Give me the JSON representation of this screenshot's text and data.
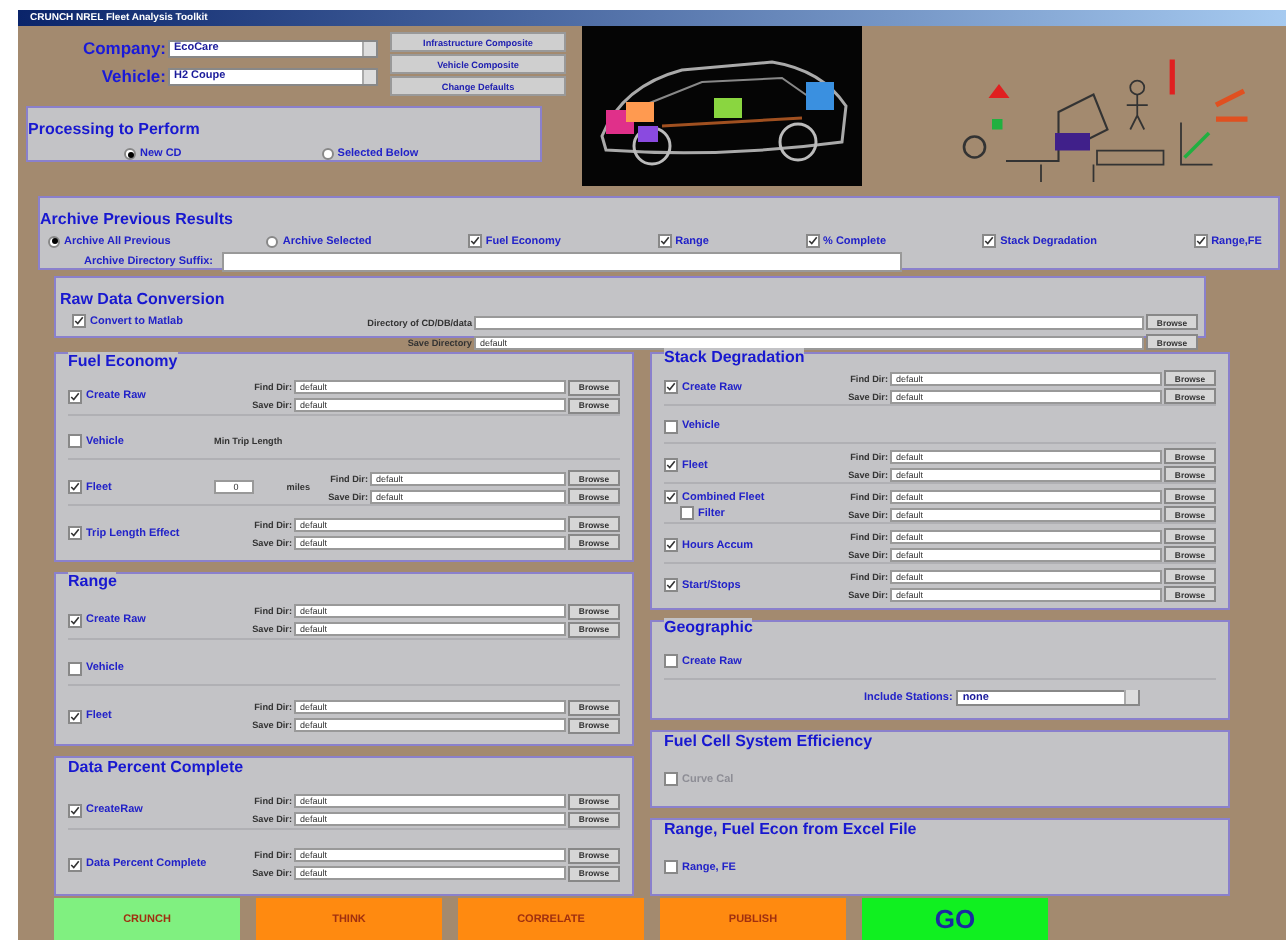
{
  "window": {
    "title": "CRUNCH NREL Fleet Analysis Toolkit"
  },
  "selectors": [
    {
      "label": "Company:",
      "value": "EcoCare"
    },
    {
      "label": "Vehicle:",
      "value": "H2 Coupe"
    }
  ],
  "top_buttons": [
    "Infrastructure Composite",
    "Vehicle Composite",
    "Change Defaults"
  ],
  "processing": {
    "title": "Processing to Perform",
    "options": [
      {
        "label": "New CD",
        "selected": true
      },
      {
        "label": "Selected Below",
        "selected": false
      }
    ]
  },
  "archive": {
    "title": "Archive Previous Results",
    "options": [
      {
        "kind": "radio",
        "label": "Archive All Previous",
        "selected": true
      },
      {
        "kind": "radio",
        "label": "Archive Selected",
        "selected": false
      },
      {
        "kind": "check",
        "label": "Fuel Economy",
        "checked": true
      },
      {
        "kind": "check",
        "label": "Range",
        "checked": true
      },
      {
        "kind": "check",
        "label": "% Complete",
        "checked": true
      },
      {
        "kind": "check",
        "label": "Stack Degradation",
        "checked": true
      },
      {
        "kind": "check",
        "label": "Range,FE",
        "checked": true
      }
    ],
    "suffix_label": "Archive Directory Suffix:"
  },
  "raw_data": {
    "title": "Raw Data Conversion",
    "label": "Convert to Matlab",
    "checked": true,
    "fields": [
      {
        "label": "Directory of CD/DB/data",
        "browse": "Browse"
      },
      {
        "label": "Save Directory",
        "value": "default",
        "browse": "Browse"
      }
    ]
  },
  "left_panels": [
    {
      "title": "Fuel Economy",
      "rows": [
        {
          "label": "Create Raw",
          "checked": true,
          "fields": [
            {
              "label": "Find Dir:",
              "value": "default",
              "browse": "Browse"
            },
            {
              "label": "Save Dir:",
              "value": "default",
              "browse": "Browse"
            }
          ]
        },
        {
          "label": "Vehicle",
          "checked": false,
          "note": "Min Trip Length"
        },
        {
          "label": "Fleet",
          "checked": true,
          "input": {
            "value": "0",
            "unit": "miles"
          },
          "fields": [
            {
              "label": "Find Dir:",
              "value": "default",
              "browse": "Browse"
            },
            {
              "label": "Save Dir:",
              "value": "default",
              "browse": "Browse"
            }
          ]
        },
        {
          "label": "Trip Length Effect",
          "checked": true,
          "fields": [
            {
              "label": "Find Dir:",
              "value": "default",
              "browse": "Browse"
            },
            {
              "label": "Save Dir:",
              "value": "default",
              "browse": "Browse"
            }
          ]
        }
      ]
    },
    {
      "title": "Range",
      "rows": [
        {
          "label": "Create Raw",
          "checked": true,
          "fields": [
            {
              "label": "Find Dir:",
              "value": "default",
              "browse": "Browse"
            },
            {
              "label": "Save Dir:",
              "value": "default",
              "browse": "Browse"
            }
          ]
        },
        {
          "label": "Vehicle",
          "checked": false
        },
        {
          "label": "Fleet",
          "checked": true,
          "fields": [
            {
              "label": "Find Dir:",
              "value": "default",
              "browse": "Browse"
            },
            {
              "label": "Save Dir:",
              "value": "default",
              "browse": "Browse"
            }
          ]
        }
      ]
    },
    {
      "title": "Data Percent Complete",
      "rows": [
        {
          "label": "CreateRaw",
          "checked": true,
          "fields": [
            {
              "label": "Find Dir:",
              "value": "default",
              "browse": "Browse"
            },
            {
              "label": "Save Dir:",
              "value": "default",
              "browse": "Browse"
            }
          ]
        },
        {
          "label": "Data Percent Complete",
          "checked": true,
          "fields": [
            {
              "label": "Find Dir:",
              "value": "default",
              "browse": "Browse"
            },
            {
              "label": "Save Dir:",
              "value": "default",
              "browse": "Browse"
            }
          ]
        }
      ]
    }
  ],
  "right_panels": [
    {
      "title": "Stack Degradation",
      "rows": [
        {
          "label": "Create Raw",
          "checked": true,
          "fields": [
            {
              "label": "Find Dir:",
              "value": "default",
              "browse": "Browse"
            },
            {
              "label": "Save Dir:",
              "value": "default",
              "browse": "Browse"
            }
          ]
        },
        {
          "label": "Vehicle",
          "checked": false
        },
        {
          "label": "Fleet",
          "checked": true,
          "fields": [
            {
              "label": "Find Dir:",
              "value": "default",
              "browse": "Browse"
            },
            {
              "label": "Save Dir:",
              "value": "default",
              "browse": "Browse"
            }
          ]
        },
        {
          "label": "Combined Fleet",
          "checked": true,
          "sub": {
            "label": "Filter",
            "checked": false
          },
          "fields": [
            {
              "label": "Find Dir:",
              "value": "default",
              "browse": "Browse"
            },
            {
              "label": "Save Dir:",
              "value": "default",
              "browse": "Browse"
            }
          ]
        },
        {
          "label": "Hours Accum",
          "checked": true,
          "fields": [
            {
              "label": "Find Dir:",
              "value": "default",
              "browse": "Browse"
            },
            {
              "label": "Save Dir:",
              "value": "default",
              "browse": "Browse"
            }
          ]
        },
        {
          "label": "Start/Stops",
          "checked": true,
          "fields": [
            {
              "label": "Find Dir:",
              "value": "default",
              "browse": "Browse"
            },
            {
              "label": "Save Dir:",
              "value": "default",
              "browse": "Browse"
            }
          ]
        }
      ]
    },
    {
      "title": "Geographic",
      "rows": [
        {
          "label": "Create Raw",
          "checked": false
        }
      ],
      "select": {
        "label": "Include Stations:",
        "value": "none"
      }
    },
    {
      "title": "Fuel Cell System Efficiency",
      "rows": [
        {
          "label": "Curve Cal",
          "checked": false,
          "disabled": true
        }
      ]
    },
    {
      "title": "Range, Fuel Econ from Excel File",
      "rows": [
        {
          "label": "Range, FE",
          "checked": false
        }
      ]
    }
  ],
  "actions": [
    {
      "label": "CRUNCH",
      "color": "#80f080"
    },
    {
      "label": "THINK",
      "color": "#ff8a10"
    },
    {
      "label": "CORRELATE",
      "color": "#ff8a10"
    },
    {
      "label": "PUBLISH",
      "color": "#ff8a10"
    },
    {
      "label": "GO",
      "color": "#10f020"
    }
  ]
}
